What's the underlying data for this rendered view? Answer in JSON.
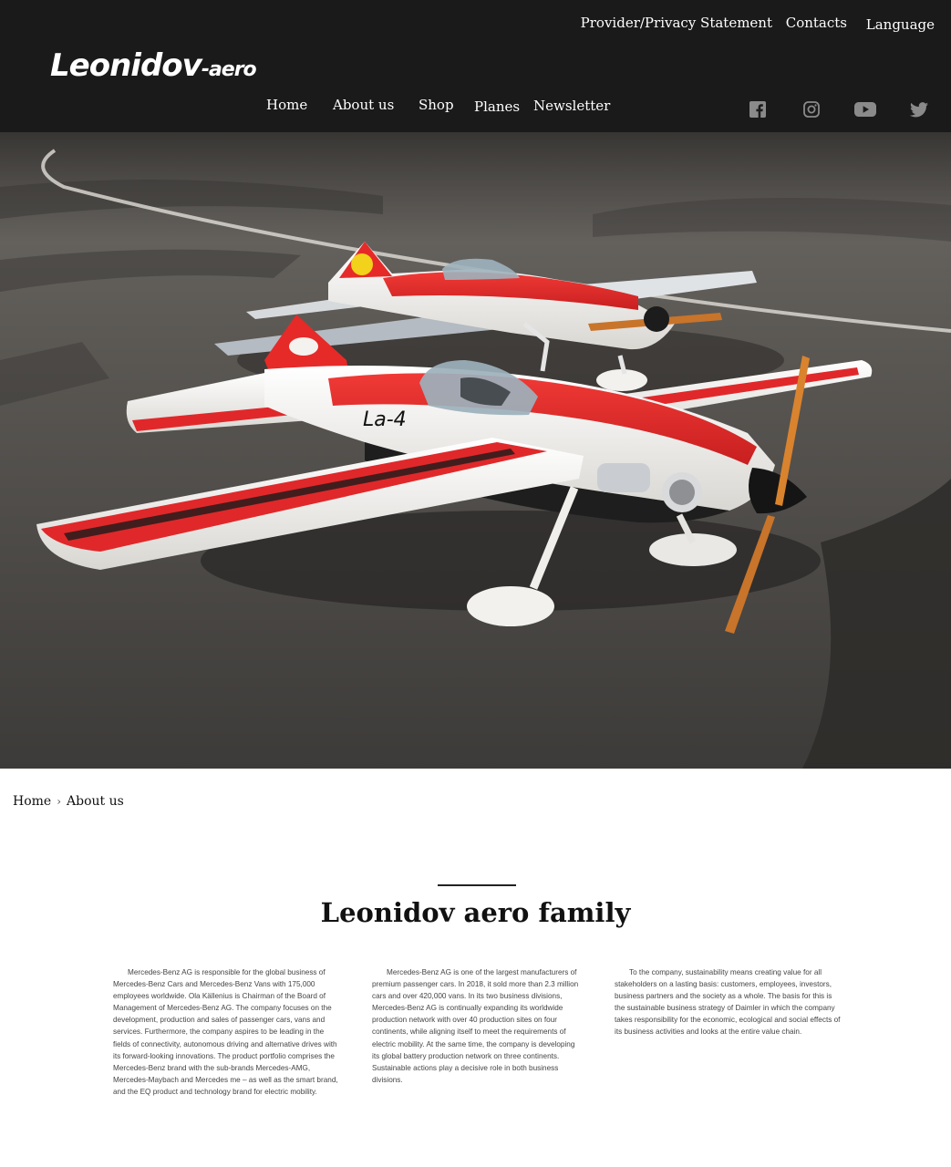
{
  "header": {
    "top_links": {
      "privacy": "Provider/Privacy Statement",
      "contacts": "Contacts",
      "language": "Language"
    },
    "logo": {
      "main": "Leonidov",
      "sub": "-aero"
    },
    "nav": [
      "Home",
      "About us",
      "Shop",
      "Planes",
      "Newsletter"
    ],
    "social": [
      "facebook-icon",
      "instagram-icon",
      "youtube-icon",
      "twitter-icon"
    ]
  },
  "breadcrumb": {
    "home": "Home",
    "separator": "›",
    "current": "About us"
  },
  "main": {
    "title": "Leonidov aero family",
    "columns": [
      "Mercedes-Benz AG is responsible for the global business of Mercedes-Benz Cars and Mercedes-Benz Vans with 175,000 employees worldwide. Ola Källenius is Chairman of the Board of Management of Mercedes-Benz AG. The company focuses on the development, production and sales of passenger cars, vans and services. Furthermore, the company aspires to be leading in the fields of connectivity, autonomous driving and alternative drives with its forward-looking innovations. The product portfolio comprises the Mercedes-Benz brand with the sub-brands Mercedes-AMG, Mercedes-Maybach and Mercedes me – as well as the smart brand, and the EQ product and technology brand for electric mobility.",
      "Mercedes-Benz AG is one of the largest manufacturers of premium passenger cars. In 2018, it sold more than 2.3 million cars and over 420,000 vans. In its two business divisions, Mercedes-Benz AG is continually expanding its worldwide production network with over 40 production sites on four continents, while aligning itself to meet the requirements of electric mobility. At the same time, the company is developing its global battery production network on three continents. Sustainable actions play a decisive role in both business divisions.",
      "To the company, sustainability means creating value for all stakeholders on a lasting basis: customers, employees, investors, business partners and the society as a whole. The basis for this is the sustainable business strategy of Daimler in which the company takes responsibility for the economic, ecological and social effects of its business activities and looks at the entire value chain."
    ]
  },
  "hero": {
    "image": "model-aerobatic-airplanes-on-tarmac",
    "fuselage_text": "La-4",
    "colors": {
      "accent": "#e0282a",
      "body": "#f2f1ee",
      "tarmac": "#4a4744",
      "prop": "#c8742a"
    }
  }
}
